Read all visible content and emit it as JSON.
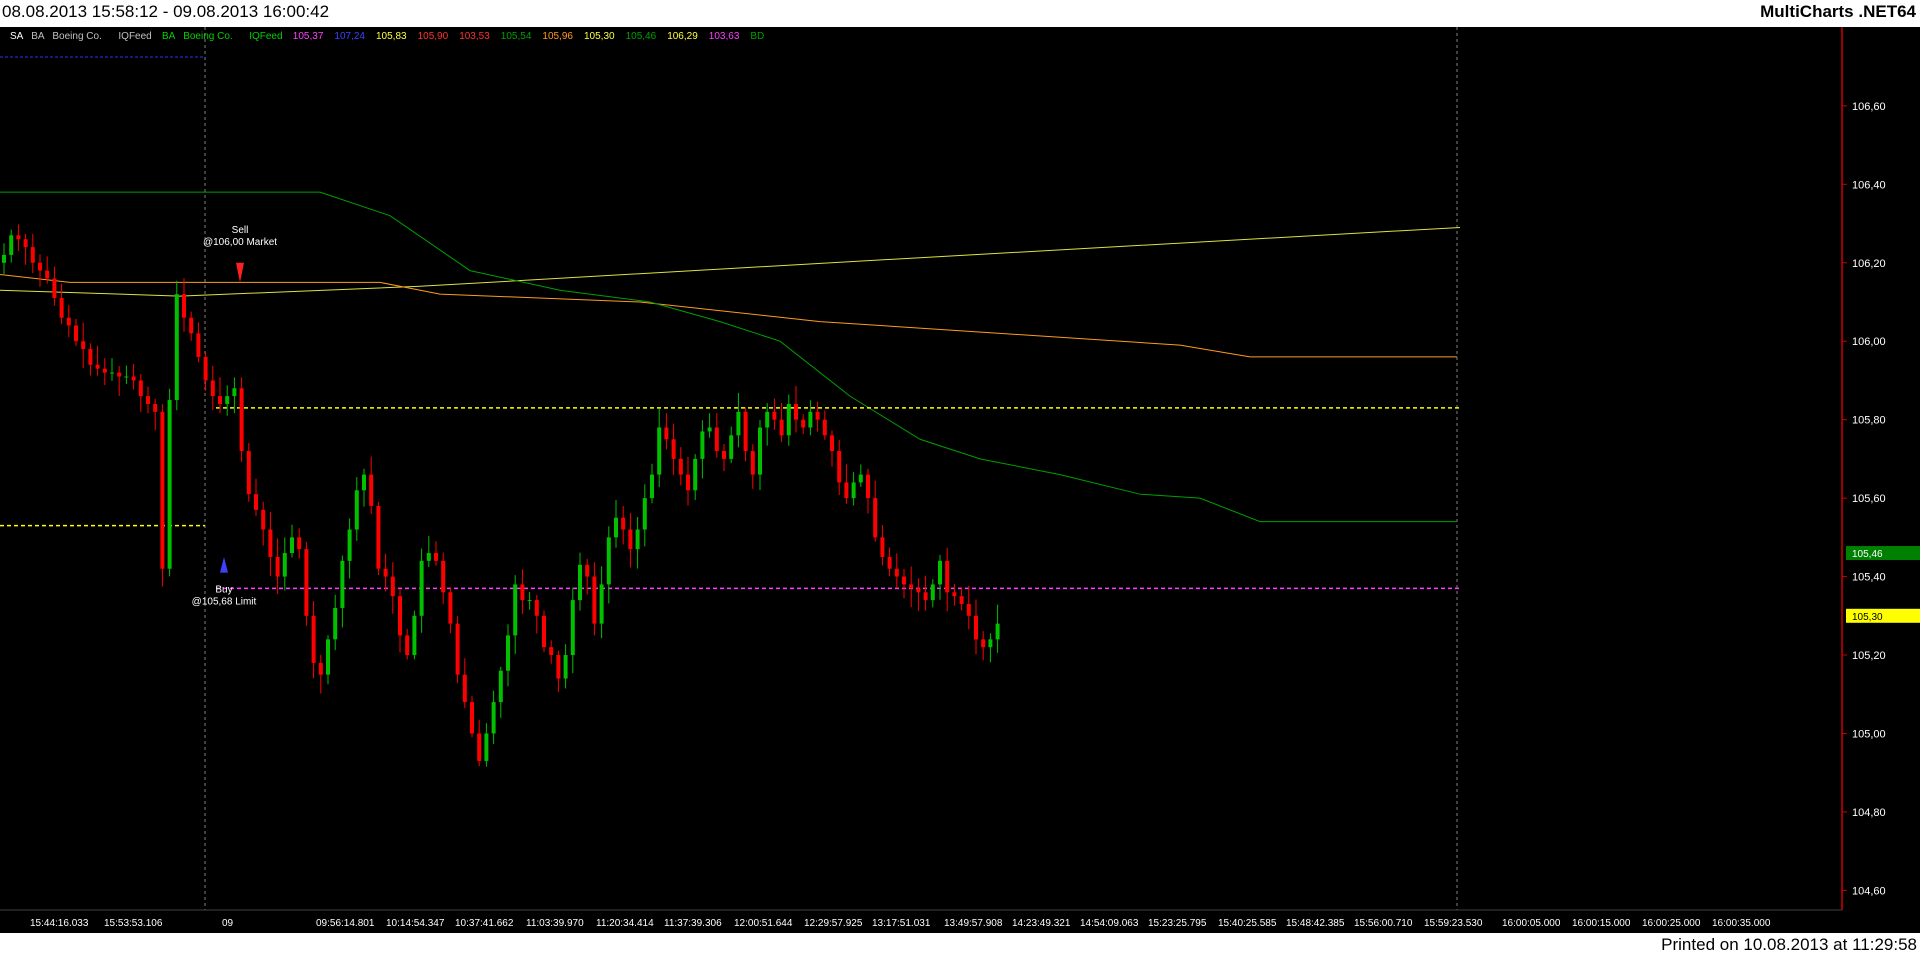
{
  "header": {
    "date_range": "08.08.2013 15:58:12 - 09.08.2013 16:00:42",
    "app_name": "MultiCharts .NET64"
  },
  "footer": {
    "printed": "Printed on 10.08.2013 at 11:29:58"
  },
  "colors": {
    "background": "#000000",
    "up_bar": "#00c000",
    "down_bar": "#ff0000",
    "axis": "#d00000",
    "yellow_line": "#e0e040",
    "orange_line": "#ff9a20",
    "green_line": "#00a000",
    "yellow_dashed": "#ffff00",
    "magenta_dashed": "#ff40ff"
  },
  "chart_data": {
    "type": "candlestick",
    "symbol_tags": [
      {
        "text": "SA",
        "color": "#ffffff"
      },
      {
        "text": "BA",
        "color": "#c0c0c0"
      },
      {
        "text": "Boeing Co.",
        "color": "#c0c0c0"
      },
      {
        "text": "IQFeed",
        "color": "#c0c0c0"
      },
      {
        "text": "BA",
        "color": "#00d000"
      },
      {
        "text": "Boeing Co.",
        "color": "#00d000"
      },
      {
        "text": "IQFeed",
        "color": "#00d000"
      }
    ],
    "indicator_values": [
      {
        "text": "105,37",
        "color": "#ff40ff"
      },
      {
        "text": "107,24",
        "color": "#4040ff"
      },
      {
        "text": "105,83",
        "color": "#ffff40"
      },
      {
        "text": "105,90",
        "color": "#ff3030"
      },
      {
        "text": "103,53",
        "color": "#ff3030"
      },
      {
        "text": "105,54",
        "color": "#00a000"
      },
      {
        "text": "105,96",
        "color": "#ff9a20"
      },
      {
        "text": "105,30",
        "color": "#ffff40"
      },
      {
        "text": "105,46",
        "color": "#00a000"
      },
      {
        "text": "106,29",
        "color": "#ffff40"
      },
      {
        "text": "103,63",
        "color": "#ff40ff"
      },
      {
        "text": "BD",
        "color": "#00a000"
      }
    ],
    "y_axis": {
      "range": [
        104.55,
        106.75
      ],
      "ticks": [
        104.6,
        104.8,
        105.0,
        105.2,
        105.4,
        105.6,
        105.8,
        106.0,
        106.2,
        106.4,
        106.6
      ],
      "tick_labels": [
        "104,60",
        "104,80",
        "105,00",
        "105,20",
        "105,40",
        "105,60",
        "105,80",
        "106,00",
        "106,20",
        "106,40",
        "106,60"
      ]
    },
    "x_labels": [
      "15:44:16.033",
      "15:53:53.106",
      "09",
      "09:56:14.801",
      "10:14:54.347",
      "10:37:41.662",
      "11:03:39.970",
      "11:20:34.414",
      "11:37:39.306",
      "12:00:51.644",
      "12:29:57.925",
      "13:17:51.031",
      "13:49:57.908",
      "14:23:49.321",
      "14:54:09.063",
      "15:23:25.795",
      "15:40:25.585",
      "15:48:42.385",
      "15:56:00.710",
      "15:59:23.530",
      "16:00:05.000",
      "16:00:15.000",
      "16:00:25.000",
      "16:00:35.000"
    ],
    "closes": [
      106.22,
      106.27,
      106.26,
      106.24,
      106.2,
      106.18,
      106.16,
      106.11,
      106.06,
      106.04,
      106.0,
      105.98,
      105.94,
      105.93,
      105.92,
      105.92,
      105.91,
      105.91,
      105.9,
      105.86,
      105.84,
      105.82,
      105.42,
      105.85,
      106.12,
      106.06,
      106.02,
      105.96,
      105.9,
      105.86,
      105.84,
      105.86,
      105.88,
      105.72,
      105.61,
      105.57,
      105.52,
      105.45,
      105.4,
      105.46,
      105.5,
      105.47,
      105.3,
      105.18,
      105.15,
      105.24,
      105.32,
      105.44,
      105.52,
      105.62,
      105.66,
      105.58,
      105.42,
      105.4,
      105.35,
      105.25,
      105.2,
      105.3,
      105.44,
      105.46,
      105.44,
      105.36,
      105.28,
      105.15,
      105.08,
      105.0,
      104.93,
      105.0,
      105.08,
      105.16,
      105.25,
      105.38,
      105.34,
      105.34,
      105.3,
      105.22,
      105.2,
      105.14,
      105.2,
      105.34,
      105.43,
      105.4,
      105.28,
      105.38,
      105.5,
      105.55,
      105.52,
      105.47,
      105.52,
      105.6,
      105.66,
      105.78,
      105.75,
      105.7,
      105.66,
      105.62,
      105.7,
      105.77,
      105.78,
      105.72,
      105.7,
      105.76,
      105.82,
      105.72,
      105.66,
      105.78,
      105.82,
      105.8,
      105.76,
      105.84,
      105.8,
      105.78,
      105.82,
      105.8,
      105.76,
      105.72,
      105.64,
      105.6,
      105.64,
      105.66,
      105.6,
      105.5,
      105.45,
      105.42,
      105.4,
      105.38,
      105.37,
      105.36,
      105.34,
      105.38,
      105.44,
      105.36,
      105.35,
      105.33,
      105.3,
      105.24,
      105.22,
      105.24,
      105.28
    ]
  }
}
